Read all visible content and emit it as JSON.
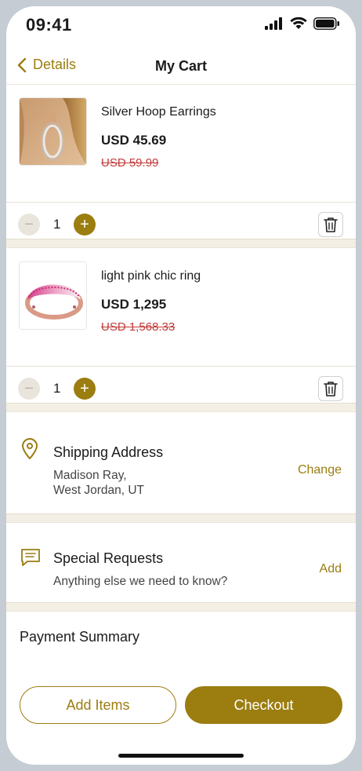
{
  "status_bar": {
    "time": "09:41"
  },
  "nav": {
    "back_label": "Details",
    "title": "My Cart"
  },
  "cart": {
    "items": [
      {
        "name": "Silver Hoop Earrings",
        "price": "USD 45.69",
        "old_price": "USD 59.99",
        "quantity": "1"
      },
      {
        "name": "light pink chic ring",
        "price": "USD 1,295",
        "old_price": "USD 1,568.33",
        "quantity": "1"
      }
    ],
    "minus_symbol": "−",
    "plus_symbol": "+"
  },
  "shipping": {
    "title": "Shipping Address",
    "line1": "Madison Ray,",
    "line2": "West Jordan, UT",
    "action": "Change"
  },
  "requests": {
    "title": "Special Requests",
    "text": "Anything else we need to know?",
    "action": "Add"
  },
  "payment": {
    "title": "Payment Summary"
  },
  "buttons": {
    "add_items": "Add Items",
    "checkout": "Checkout"
  },
  "colors": {
    "accent": "#9b7d10",
    "strike_price": "#c23a3a",
    "separator": "#f3efe4"
  },
  "icons": [
    "chevron-left-icon",
    "signal-icon",
    "wifi-icon",
    "battery-icon",
    "minus-icon",
    "plus-icon",
    "trash-icon",
    "location-pin-icon",
    "message-icon"
  ]
}
